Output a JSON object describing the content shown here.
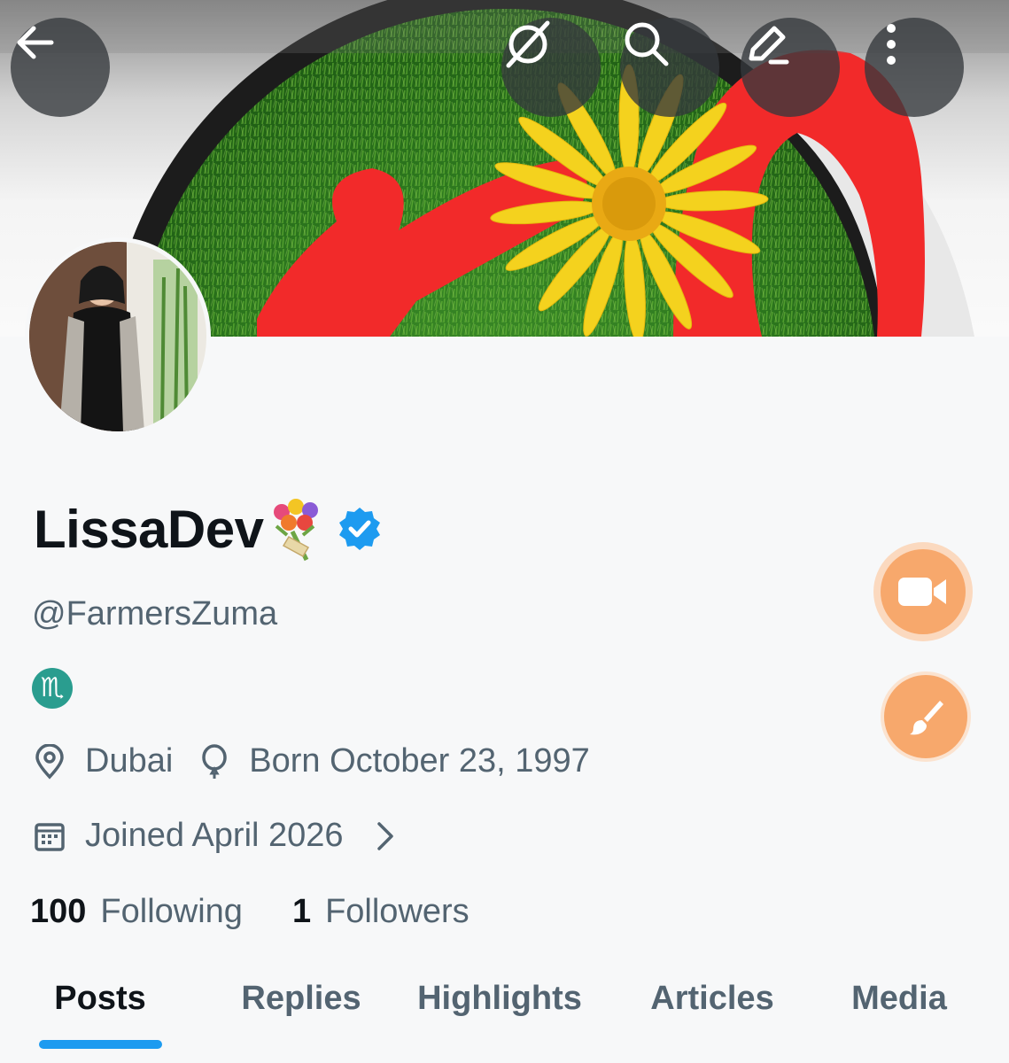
{
  "header": {
    "back_icon": "arrow-left-icon",
    "actions": [
      {
        "name": "grok-icon"
      },
      {
        "name": "search-icon"
      },
      {
        "name": "edit-icon"
      },
      {
        "name": "more-vertical-icon"
      }
    ]
  },
  "profile": {
    "display_name": "LissaDev",
    "name_emoji": "bouquet-emoji",
    "verified": true,
    "verified_color": "#1d9bf0",
    "handle": "@FarmersZuma",
    "bio_glyph": "♏",
    "location": "Dubai",
    "birthday": "Born October 23, 1997",
    "joined": "Joined April 2026",
    "following_count": "100",
    "following_label": "Following",
    "followers_count": "1",
    "followers_label": "Followers"
  },
  "floating_actions": [
    {
      "name": "video-camera-icon",
      "color": "#f7a86c"
    },
    {
      "name": "paintbrush-icon",
      "color": "#f7a86c"
    }
  ],
  "tabs": [
    {
      "label": "Posts",
      "active": true
    },
    {
      "label": "Replies",
      "active": false
    },
    {
      "label": "Highlights",
      "active": false
    },
    {
      "label": "Articles",
      "active": false
    },
    {
      "label": "Media",
      "active": false
    }
  ],
  "colors": {
    "accent": "#1d9bf0",
    "secondary_text": "#536471",
    "primary_text": "#0f1419",
    "fab": "#f7a86c"
  }
}
